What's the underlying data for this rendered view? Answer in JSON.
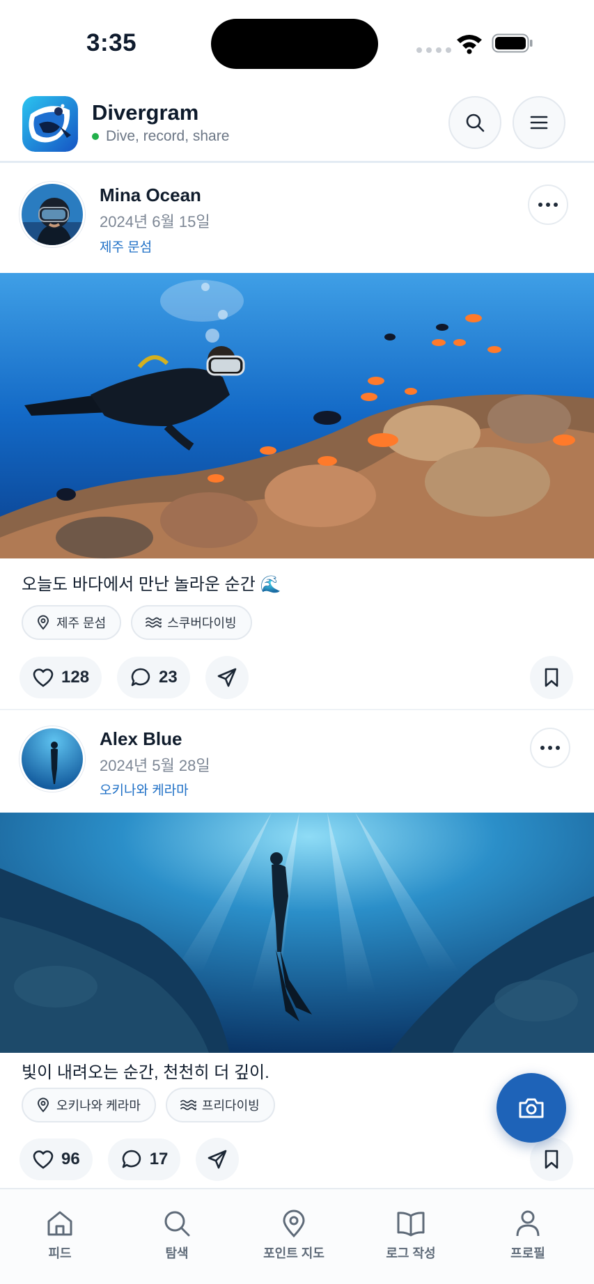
{
  "status_bar": {
    "time": "3:35"
  },
  "header": {
    "title": "Divergram",
    "subtitle": "Dive, record, share",
    "accent": "#1e63b8",
    "online_color": "#22b04b",
    "search_icon": "search-icon",
    "menu_icon": "menu-icon"
  },
  "posts": [
    {
      "author": "Mina Ocean",
      "date": "2024년 6월 15일",
      "location": "제주 문섬",
      "caption": "오늘도 바다에서 만난 놀라운 순간 🌊",
      "tags": [
        {
          "icon": "location-pin-icon",
          "label": "제주 문섬"
        },
        {
          "icon": "waves-icon",
          "label": "스쿠버다이빙"
        }
      ],
      "likes": "128",
      "comments": "23"
    },
    {
      "author": "Alex Blue",
      "date": "2024년 5월 28일",
      "location": "오키나와 케라마",
      "caption": "빛이 내려오는 순간, 천천히 더 깊이.",
      "tags": [
        {
          "icon": "location-pin-icon",
          "label": "오키나와 케라마"
        },
        {
          "icon": "waves-icon",
          "label": "프리다이빙"
        }
      ],
      "likes": "96",
      "comments": "17"
    }
  ],
  "fab": {
    "icon": "camera-icon"
  },
  "nav": [
    {
      "icon": "home-icon",
      "label": "피드"
    },
    {
      "icon": "search-icon",
      "label": "탐색"
    },
    {
      "icon": "map-pin-icon",
      "label": "포인트 지도"
    },
    {
      "icon": "book-icon",
      "label": "로그 작성"
    },
    {
      "icon": "user-icon",
      "label": "프로필"
    }
  ]
}
